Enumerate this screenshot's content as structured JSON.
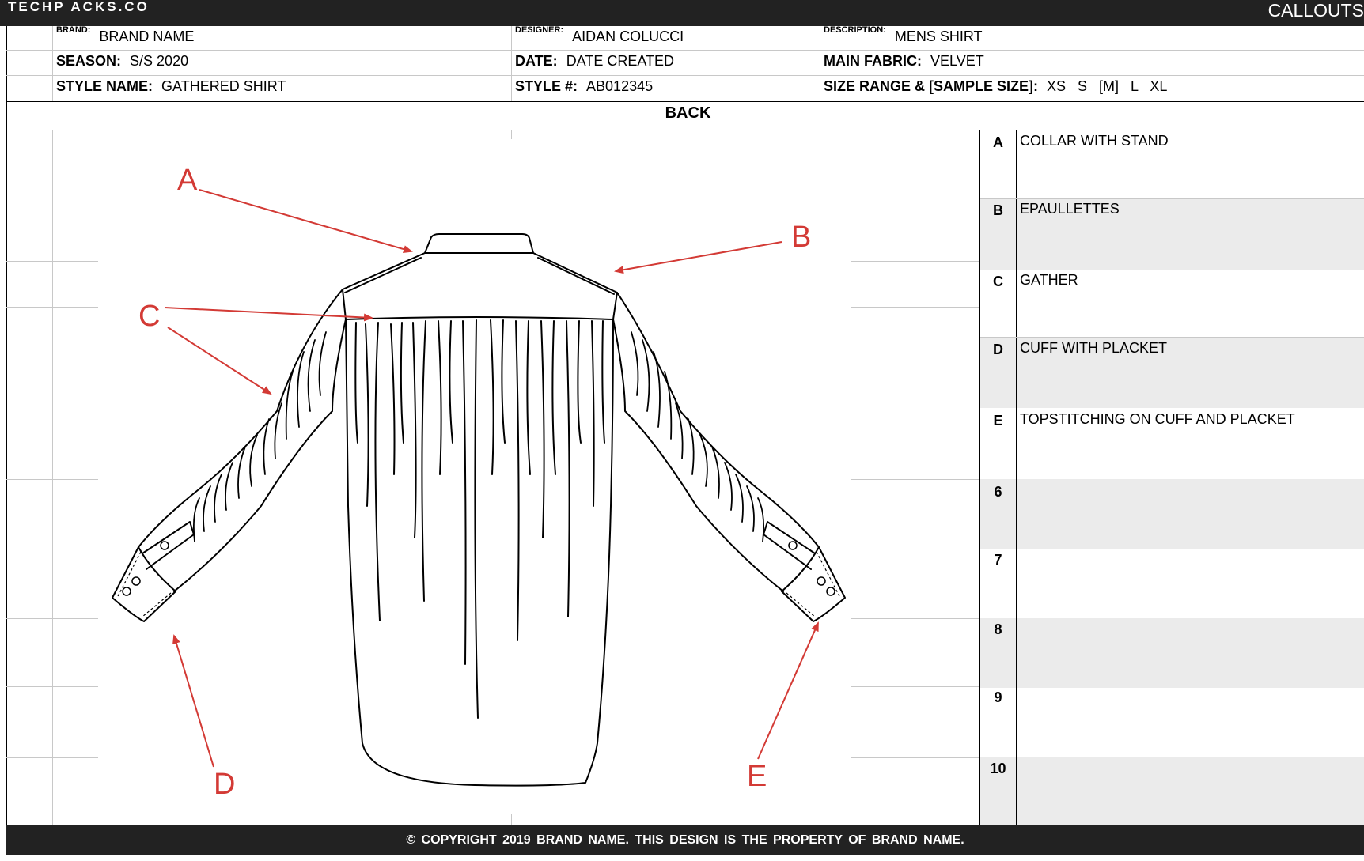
{
  "header": {
    "logo": "TECHP ACKS.CO",
    "page_title": "CALLOUTS"
  },
  "info": {
    "brand_label": "BRAND:",
    "brand_value": "BRAND NAME",
    "designer_label": "DESIGNER:",
    "designer_value": "AIDAN COLUCCI",
    "description_label": "DESCRIPTION:",
    "description_value": "MENS SHIRT",
    "season_label": "SEASON:",
    "season_value": "S/S 2020",
    "date_label": "DATE:",
    "date_value": "DATE CREATED",
    "fabric_label": "MAIN FABRIC:",
    "fabric_value": "VELVET",
    "style_name_label": "STYLE NAME:",
    "style_name_value": "GATHERED SHIRT",
    "style_num_label": "STYLE #:",
    "style_num_value": "AB012345",
    "size_label": "SIZE RANGE & [SAMPLE SIZE]:",
    "size_value": "XS   S   [M]   L   XL"
  },
  "view_title": "BACK",
  "sketch_labels": {
    "a": "A",
    "b": "B",
    "c": "C",
    "d": "D",
    "e": "E"
  },
  "callouts": [
    {
      "key": "A",
      "text": "COLLAR WITH STAND"
    },
    {
      "key": "B",
      "text": "EPAULLETTES"
    },
    {
      "key": "C",
      "text": "GATHER"
    },
    {
      "key": "D",
      "text": "CUFF WITH PLACKET"
    },
    {
      "key": "E",
      "text": "TOPSTITCHING ON CUFF AND PLACKET"
    },
    {
      "key": "6",
      "text": ""
    },
    {
      "key": "7",
      "text": ""
    },
    {
      "key": "8",
      "text": ""
    },
    {
      "key": "9",
      "text": ""
    },
    {
      "key": "10",
      "text": ""
    }
  ],
  "footer": {
    "copyright": "© COPYRIGHT 2019 BRAND NAME.  THIS DESIGN IS THE PROPERTY OF BRAND NAME."
  },
  "colors": {
    "bar": "#222222",
    "arrow": "#d33a35",
    "shade": "#ebebeb"
  }
}
